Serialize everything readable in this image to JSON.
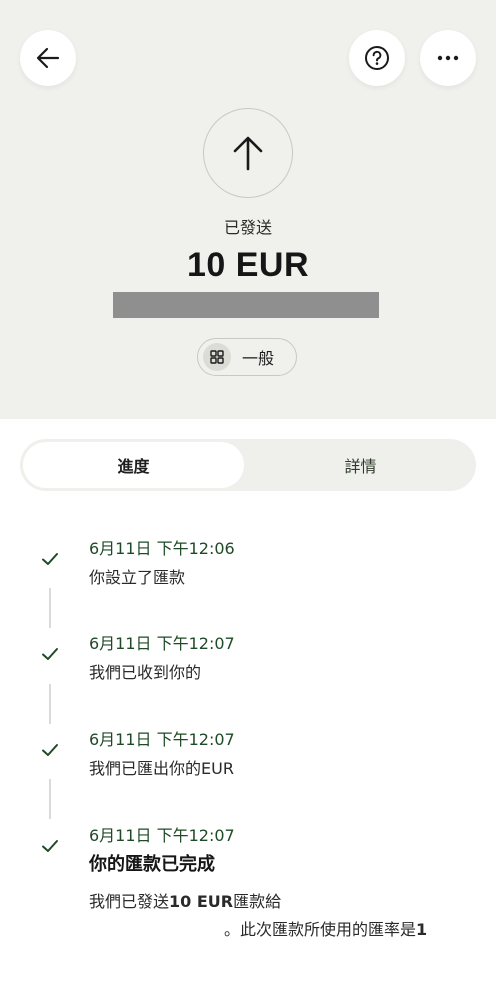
{
  "header": {
    "back_icon": "arrow-left-icon",
    "help_icon": "question-circle-icon",
    "more_icon": "more-dots-icon"
  },
  "transfer": {
    "status_icon": "arrow-up-icon",
    "status_label": "已發送",
    "amount": "10 EUR",
    "category_icon": "grid-icon",
    "category_label": "一般"
  },
  "tabs": {
    "progress": "進度",
    "details": "詳情"
  },
  "timeline": [
    {
      "date": "6月11日 下午12:06",
      "text": "你設立了匯款"
    },
    {
      "date": "6月11日 下午12:07",
      "text": "我們已收到你的"
    },
    {
      "date": "6月11日 下午12:07",
      "text": "我們已匯出你的EUR"
    },
    {
      "date": "6月11日 下午12:07",
      "text": "你的匯款已完成"
    }
  ],
  "completion_note": {
    "line1_prefix": "我們已發送",
    "line1_amount": "10 EUR",
    "line1_suffix": "匯款給",
    "line2_prefix": "。此次匯款所使用的匯率是",
    "line2_rate": "1"
  },
  "colors": {
    "hero_bg": "#f0f0ec",
    "accent_green": "#1f4a27",
    "redaction": "#8f8f8f"
  }
}
